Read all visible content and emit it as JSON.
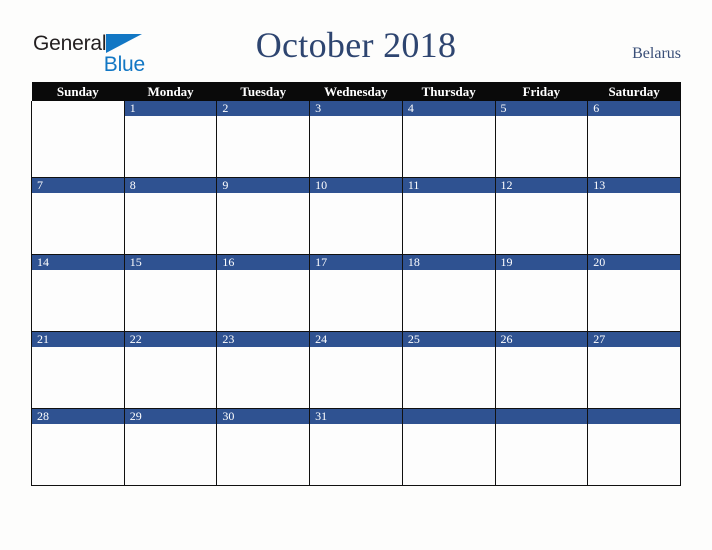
{
  "brand": {
    "name_part1": "General",
    "name_part2": "Blue",
    "triangle_icon": "triangle-icon",
    "color_dark": "#231f20",
    "color_blue": "#1277c4"
  },
  "header": {
    "title": "October 2018",
    "country": "Belarus",
    "title_color": "#2e4570"
  },
  "calendar": {
    "weekday_headers": [
      "Sunday",
      "Monday",
      "Tuesday",
      "Wednesday",
      "Thursday",
      "Friday",
      "Saturday"
    ],
    "header_bg": "#0a0a0a",
    "daynum_bg": "#2f5291",
    "cell_bg": "#fdfdfd",
    "weeks": [
      [
        {
          "num": "",
          "filled": false
        },
        {
          "num": "1",
          "filled": true
        },
        {
          "num": "2",
          "filled": true
        },
        {
          "num": "3",
          "filled": true
        },
        {
          "num": "4",
          "filled": true
        },
        {
          "num": "5",
          "filled": true
        },
        {
          "num": "6",
          "filled": true
        }
      ],
      [
        {
          "num": "7",
          "filled": true
        },
        {
          "num": "8",
          "filled": true
        },
        {
          "num": "9",
          "filled": true
        },
        {
          "num": "10",
          "filled": true
        },
        {
          "num": "11",
          "filled": true
        },
        {
          "num": "12",
          "filled": true
        },
        {
          "num": "13",
          "filled": true
        }
      ],
      [
        {
          "num": "14",
          "filled": true
        },
        {
          "num": "15",
          "filled": true
        },
        {
          "num": "16",
          "filled": true
        },
        {
          "num": "17",
          "filled": true
        },
        {
          "num": "18",
          "filled": true
        },
        {
          "num": "19",
          "filled": true
        },
        {
          "num": "20",
          "filled": true
        }
      ],
      [
        {
          "num": "21",
          "filled": true
        },
        {
          "num": "22",
          "filled": true
        },
        {
          "num": "23",
          "filled": true
        },
        {
          "num": "24",
          "filled": true
        },
        {
          "num": "25",
          "filled": true
        },
        {
          "num": "26",
          "filled": true
        },
        {
          "num": "27",
          "filled": true
        }
      ],
      [
        {
          "num": "28",
          "filled": true
        },
        {
          "num": "29",
          "filled": true
        },
        {
          "num": "30",
          "filled": true
        },
        {
          "num": "31",
          "filled": true
        },
        {
          "num": "",
          "filled": true
        },
        {
          "num": "",
          "filled": true
        },
        {
          "num": "",
          "filled": true
        }
      ]
    ]
  }
}
